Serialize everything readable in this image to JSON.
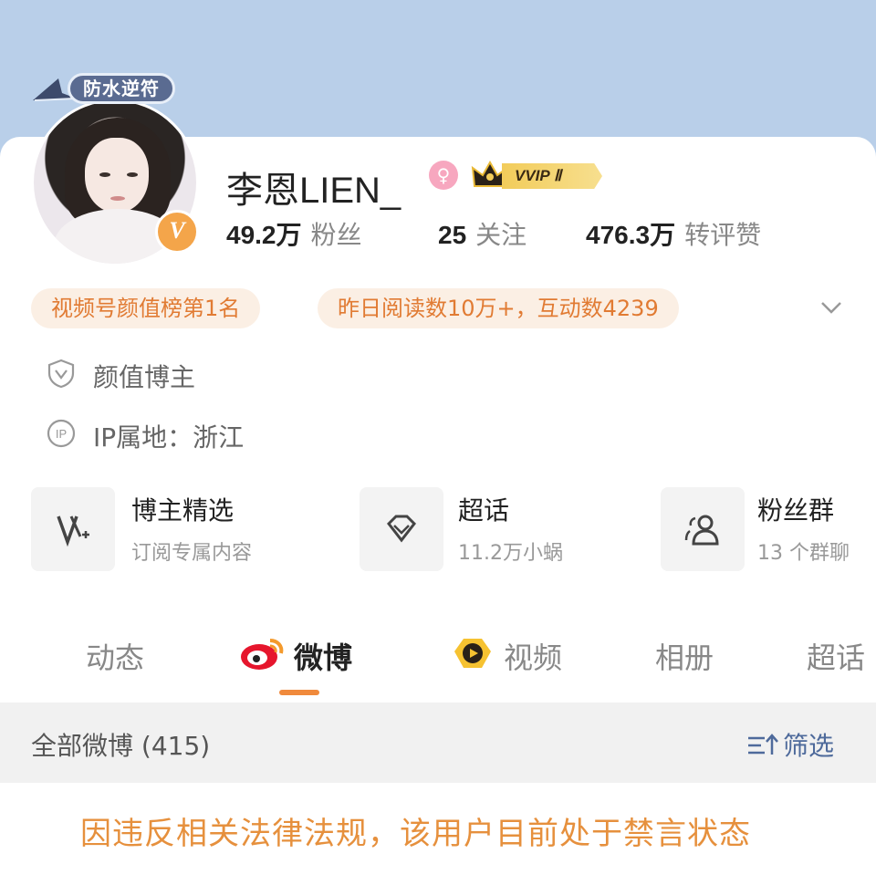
{
  "profile": {
    "avatar_sticker_text": "防水逆符",
    "name": "李恩LIEN_",
    "gender_symbol": "♀",
    "vip_label": "VVIP Ⅱ",
    "verify_badge": "V"
  },
  "stats": [
    {
      "num": "49.2",
      "unit": "万",
      "label": "粉丝"
    },
    {
      "num": "25",
      "unit": "",
      "label": "关注"
    },
    {
      "num": "476.3",
      "unit": "万",
      "label": "转评赞"
    }
  ],
  "chips": [
    "视频号颜值榜第1名",
    "昨日阅读数10万+，互动数4239"
  ],
  "info": {
    "category": "颜值博主",
    "ip_location": "IP属地：浙江"
  },
  "features": [
    {
      "title": "博主精选",
      "subtitle": "订阅专属内容",
      "icon": "v-plus-icon"
    },
    {
      "title": "超话",
      "subtitle": "11.2万小蜗",
      "icon": "diamond-icon"
    },
    {
      "title": "粉丝群",
      "subtitle": "13 个群聊",
      "icon": "group-icon"
    }
  ],
  "tabs": [
    "动态",
    "微博",
    "视频",
    "相册",
    "超话"
  ],
  "active_tab": "微博",
  "feed": {
    "title": "全部微博 (415)",
    "filter_label": "筛选"
  },
  "notice": "因违反相关法律法规，该用户目前处于禁言状态",
  "colors": {
    "banner": "#b9cfe9",
    "accent_orange": "#f08a3c",
    "chip_bg": "#fbefe4",
    "chip_text": "#e17b33",
    "filter_blue": "#4e6a9b",
    "notice": "#e6903d"
  }
}
